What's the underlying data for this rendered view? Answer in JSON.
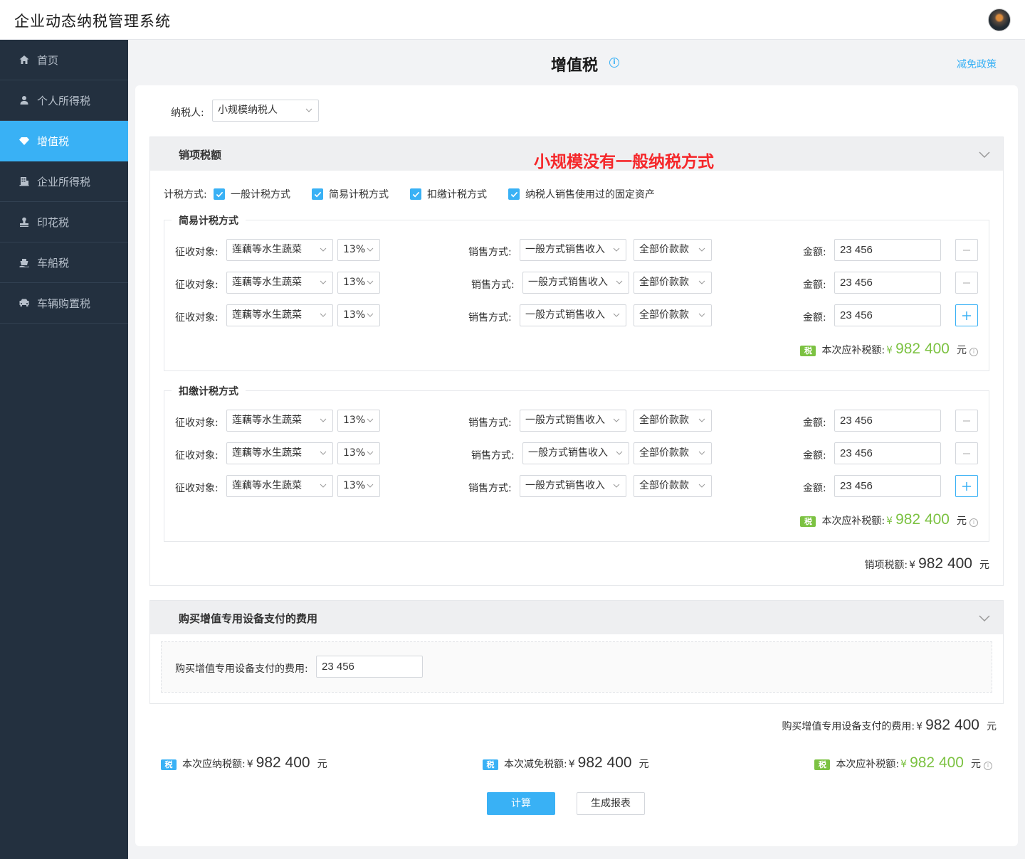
{
  "app": {
    "title": "企业动态纳税管理系统"
  },
  "sidebar": {
    "items": [
      {
        "label": "首页",
        "icon": "home-icon",
        "active": false
      },
      {
        "label": "个人所得税",
        "icon": "person-icon",
        "active": false
      },
      {
        "label": "增值税",
        "icon": "diamond-icon",
        "active": true
      },
      {
        "label": "企业所得税",
        "icon": "building-icon",
        "active": false
      },
      {
        "label": "印花税",
        "icon": "stamp-icon",
        "active": false
      },
      {
        "label": "车船税",
        "icon": "ship-icon",
        "active": false
      },
      {
        "label": "车辆购置税",
        "icon": "car-icon",
        "active": false
      }
    ]
  },
  "header": {
    "title": "增值税",
    "policy_link": "减免政策"
  },
  "taxpayer": {
    "label": "纳税人:",
    "value": "小规模纳税人"
  },
  "sales_panel": {
    "title": "销项税额",
    "annotation": "小规模没有一般纳税方式",
    "method_label": "计税方式:",
    "methods": [
      {
        "label": "一般计税方式",
        "checked": true
      },
      {
        "label": "简易计税方式",
        "checked": true
      },
      {
        "label": "扣缴计税方式",
        "checked": true
      },
      {
        "label": "纳税人销售使用过的固定资产",
        "checked": true
      }
    ],
    "groups": [
      {
        "legend": "简易计税方式",
        "rows": [
          {
            "object_label": "征收对象:",
            "object": "莲藕等水生蔬菜",
            "rate": "13%",
            "sale_label": "销售方式:",
            "sale": "一般方式销售收入",
            "scope": "全部价款款",
            "amount_label": "金额:",
            "amount": "23 456",
            "action": "minus"
          },
          {
            "object_label": "征收对象:",
            "object": "莲藕等水生蔬菜",
            "rate": "13%",
            "sale_label": "销售方式:",
            "sale": "一般方式销售收入",
            "scope": "全部价款款",
            "amount_label": "金额:",
            "amount": "23 456",
            "action": "minus"
          },
          {
            "object_label": "征收对象:",
            "object": "莲藕等水生蔬菜",
            "rate": "13%",
            "sale_label": "销售方式:",
            "sale": "一般方式销售收入",
            "scope": "全部价款款",
            "amount_label": "金额:",
            "amount": "23 456",
            "action": "plus"
          }
        ],
        "subtotal": {
          "badge": "税",
          "label": "本次应补税额:",
          "currency": "¥",
          "amount": "982 400",
          "unit": "元"
        }
      },
      {
        "legend": "扣缴计税方式",
        "rows": [
          {
            "object_label": "征收对象:",
            "object": "莲藕等水生蔬菜",
            "rate": "13%",
            "sale_label": "销售方式:",
            "sale": "一般方式销售收入",
            "scope": "全部价款款",
            "amount_label": "金额:",
            "amount": "23 456",
            "action": "minus"
          },
          {
            "object_label": "征收对象:",
            "object": "莲藕等水生蔬菜",
            "rate": "13%",
            "sale_label": "销售方式:",
            "sale": "一般方式销售收入",
            "scope": "全部价款款",
            "amount_label": "金额:",
            "amount": "23 456",
            "action": "minus"
          },
          {
            "object_label": "征收对象:",
            "object": "莲藕等水生蔬菜",
            "rate": "13%",
            "sale_label": "销售方式:",
            "sale": "一般方式销售收入",
            "scope": "全部价款款",
            "amount_label": "金额:",
            "amount": "23 456",
            "action": "plus"
          }
        ],
        "subtotal": {
          "badge": "税",
          "label": "本次应补税额:",
          "currency": "¥",
          "amount": "982 400",
          "unit": "元"
        }
      }
    ],
    "total": {
      "label": "销项税额:",
      "currency": "¥",
      "amount": "982 400",
      "unit": "元"
    }
  },
  "equipment_panel": {
    "title": "购买增值专用设备支付的费用",
    "field_label": "购买增值专用设备支付的费用:",
    "field_value": "23 456",
    "total": {
      "label": "购买增值专用设备支付的费用:",
      "currency": "¥",
      "amount": "982 400",
      "unit": "元"
    }
  },
  "summary": {
    "payable": {
      "badge": "税",
      "label": "本次应纳税额:",
      "currency": "¥",
      "amount": "982 400",
      "unit": "元"
    },
    "reduced": {
      "badge": "税",
      "label": "本次减免税额:",
      "currency": "¥",
      "amount": "982 400",
      "unit": "元"
    },
    "supplement": {
      "badge": "税",
      "label": "本次应补税额:",
      "currency": "¥",
      "amount": "982 400",
      "unit": "元"
    }
  },
  "actions": {
    "calculate": "计算",
    "report": "生成报表"
  },
  "colors": {
    "primary": "#39b1f5",
    "sidebar_bg": "#23303f",
    "accent_green": "#7cc242",
    "annotation_red": "#f5272a"
  }
}
